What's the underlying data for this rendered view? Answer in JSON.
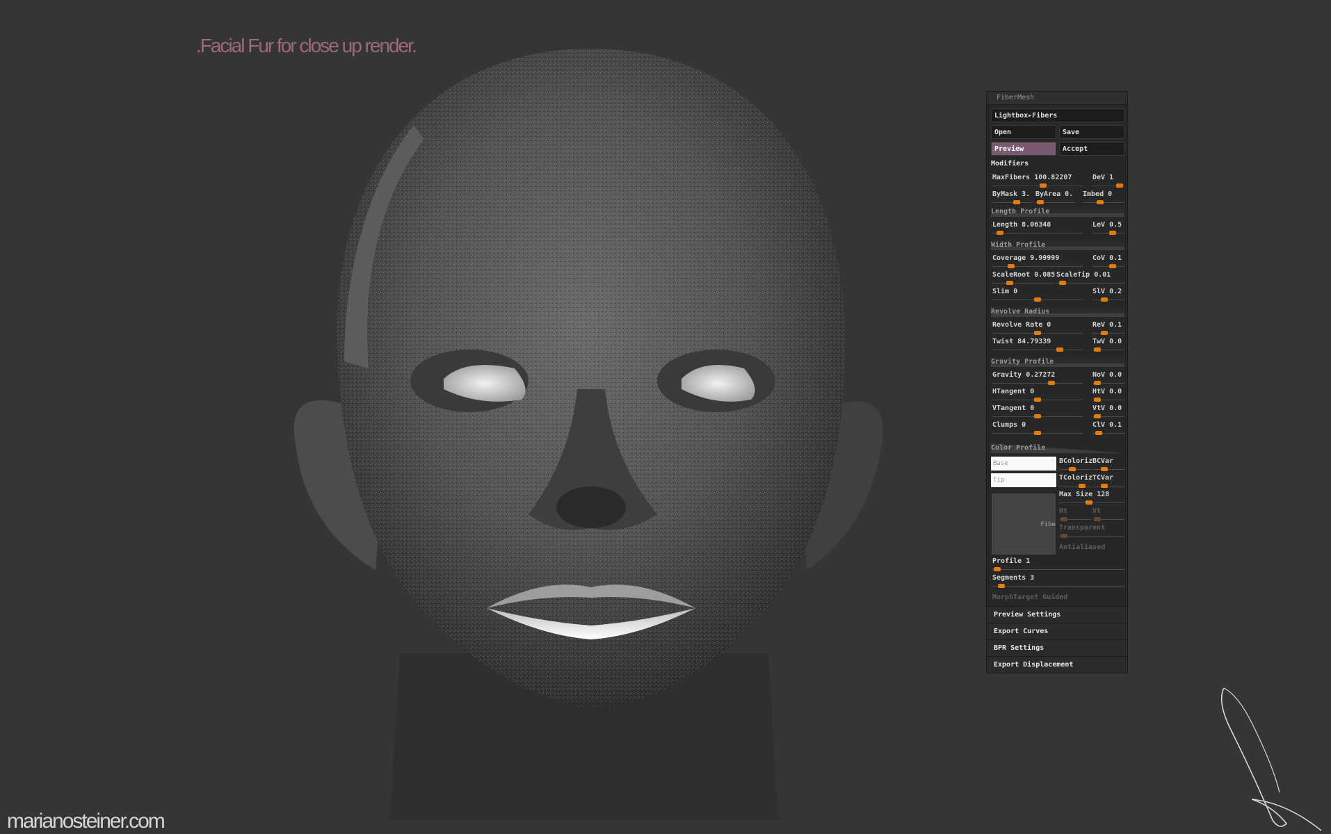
{
  "caption": ".Facial Fur for close up render.",
  "watermark": "marianosteiner.com",
  "panel": {
    "title": "FiberMesh",
    "lightbox": "Lightbox▸Fibers",
    "open": "Open",
    "save": "Save",
    "preview": "Preview",
    "accept": "Accept",
    "modifiers": "Modifiers",
    "sliders": {
      "maxfibers": {
        "label": "MaxFibers",
        "value": "100.82207"
      },
      "dev": {
        "label": "DeV",
        "value": "1"
      },
      "bymask": {
        "label": "ByMask",
        "value": "3."
      },
      "byarea": {
        "label": "ByArea",
        "value": "0."
      },
      "imbed": {
        "label": "Imbed",
        "value": "0"
      },
      "length": {
        "label": "Length",
        "value": "8.06348"
      },
      "lev": {
        "label": "LeV",
        "value": "0.5"
      },
      "coverage": {
        "label": "Coverage",
        "value": "9.99999"
      },
      "cov": {
        "label": "CoV",
        "value": "0.1"
      },
      "scaleroot": {
        "label": "ScaleRoot",
        "value": "0.085"
      },
      "scaletip": {
        "label": "ScaleTip",
        "value": "0.01"
      },
      "slim": {
        "label": "Slim",
        "value": "0"
      },
      "slv": {
        "label": "SlV",
        "value": "0.2"
      },
      "revolverate": {
        "label": "Revolve Rate",
        "value": "0"
      },
      "rev": {
        "label": "ReV",
        "value": "0.1"
      },
      "twist": {
        "label": "Twist",
        "value": "84.79339"
      },
      "twv": {
        "label": "TwV",
        "value": "0.0"
      },
      "gravity": {
        "label": "Gravity",
        "value": "0.27272"
      },
      "nov": {
        "label": "NoV",
        "value": "0.0"
      },
      "htangent": {
        "label": "HTangent",
        "value": "0"
      },
      "htv": {
        "label": "HtV",
        "value": "0.0"
      },
      "vtangent": {
        "label": "VTangent",
        "value": "0"
      },
      "vtv": {
        "label": "VtV",
        "value": "0.0"
      },
      "clumps": {
        "label": "Clumps",
        "value": "0"
      },
      "clv": {
        "label": "ClV",
        "value": "0.1"
      },
      "maxsize": {
        "label": "Max Size",
        "value": "128"
      },
      "profile": {
        "label": "Profile",
        "value": "1"
      },
      "segments": {
        "label": "Segments",
        "value": "3"
      }
    },
    "headers": {
      "length_profile": "Length Profile",
      "width_profile": "Width Profile",
      "revolve_radius": "Revolve Radius",
      "gravity_profile": "Gravity Profile",
      "color_profile": "Color Profile"
    },
    "base": "Base",
    "tip": "Tip",
    "bcolorize": "BColoriz",
    "bcvar": "BCVar",
    "tcolorize": "TColoriz",
    "tcvar": "TCVar",
    "ht": "Ht",
    "vt": "Vt",
    "transparent": "Transparent",
    "antialiased": "Antialiased",
    "fibe": "Fibe",
    "morph": "MorphTarget Guided",
    "menu": [
      "Preview Settings",
      "Export Curves",
      "BPR Settings",
      "Export Displacement"
    ],
    "accent": "#e27b12"
  }
}
